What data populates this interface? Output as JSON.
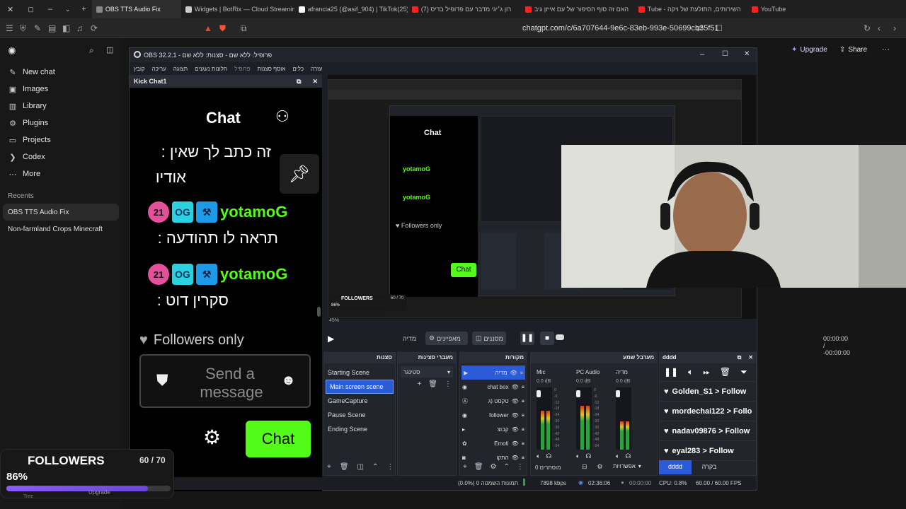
{
  "browser": {
    "tabs": [
      {
        "label": "OBS TTS Audio Fix",
        "active": true,
        "color": "#888888"
      },
      {
        "label": "Widgets | BotRix — Cloud Streamin",
        "active": false,
        "color": "#cccccc"
      },
      {
        "label": "afrancia25 (@asif_904) | TikTok(25)",
        "active": false,
        "color": "#ffffff"
      },
      {
        "label": "(7) רון ג׳יגי מדבר עם פדופיל בדיס",
        "active": false,
        "color": "#ff2020"
      },
      {
        "label": "האם זה סוף הסיפור של עם אייזן גיב",
        "active": false,
        "color": "#ff2020"
      },
      {
        "label": "Tube - השירותים, התולעת של ויקה",
        "active": false,
        "color": "#ff2020"
      },
      {
        "label": "YouTube",
        "active": false,
        "color": "#ff2020"
      }
    ],
    "url": "chatgpt.com/c/6a707644-9e6c-83eb-993e-50699cb35f51"
  },
  "sidebar": {
    "items": [
      {
        "label": "New chat",
        "icon": "edit-icon"
      },
      {
        "label": "Images",
        "icon": "image-icon"
      },
      {
        "label": "Library",
        "icon": "library-icon"
      },
      {
        "label": "Plugins",
        "icon": "plugins-icon"
      },
      {
        "label": "Projects",
        "icon": "folder-icon"
      },
      {
        "label": "Codex",
        "icon": "codex-icon"
      },
      {
        "label": "More",
        "icon": "more-icon"
      }
    ],
    "recent_heading": "Recents",
    "recents": [
      "OBS TTS Audio Fix",
      "Non-farmland Crops Minecraft"
    ]
  },
  "gpt_header": {
    "upgrade": "Upgrade",
    "share": "Share",
    "more": "···"
  },
  "obs": {
    "title": "OBS 32.2.1 - פרופיל: ללא שם - סצנות: ללא שם",
    "menu": [
      "קובץ",
      "עריכה",
      "תצוגה",
      "חלונות נעגנים",
      "פרופיל",
      "אוסף סצנות",
      "כלים",
      "עזרה"
    ],
    "dock_title": "Kick Chat1",
    "chat": {
      "header": "Chat",
      "line1": "זה כתב לך שאין :",
      "line1b": "אודיו",
      "user": "yotamoG",
      "badge": "21",
      "msg2": "תראה לו תהודעה :",
      "msg3": "סקרין דוט :",
      "followers_only": "Followers only",
      "send_placeholder_1": "Send a",
      "send_placeholder_2": "message",
      "chat_button": "Chat"
    },
    "controls": {
      "transition": "מדיה",
      "properties": "מאפיינים",
      "filters": "מסננים",
      "time": "00:00:00 / -00:00:00"
    },
    "scenes_title": "סצנות",
    "scenes": [
      "Starting Scene",
      "Main screen scene",
      "GameCapture",
      "Pause Scene",
      "Ending Scene"
    ],
    "selected_scene": "Main screen scene",
    "transitions_title": "מעברי סצינות",
    "transition_select": "סטינגר",
    "sources_title": "מקורות",
    "sources": [
      "מדיה",
      "chat box",
      "טקסט (ג",
      "follower",
      "קבוצ",
      "Emoti",
      "התקו"
    ],
    "mixer_title": "מערבל שמע",
    "mixer": [
      {
        "name": "Mic",
        "db": "0.0 dB",
        "level": 0.62
      },
      {
        "name": "PC Audio",
        "db": "0.0 dB",
        "level": 0.7
      },
      {
        "name": "מדיה",
        "db": "0.0 dB",
        "level": 0.45
      }
    ],
    "mixer_ticks": [
      "0",
      "-6",
      "-12",
      "-18",
      "-24",
      "-30",
      "-36",
      "-42",
      "-48",
      "-54"
    ],
    "mixer_footer": "0 מוסתרים",
    "advanced": "אפשרויות",
    "dock2_title": "dddd",
    "follow_list": [
      "Golden_S1 > Follow",
      "mordechai122 > Follo",
      "nadav09876 > Follow",
      "eyal283 > Follow"
    ],
    "dock_tabs": [
      "dddd",
      "בקרה"
    ],
    "status": {
      "dropped": "(0.0%) 0 תמונות השמטה",
      "kbps": "7898 kbps",
      "rec": "02:36:06",
      "stream": "00:00:00",
      "cpu": "CPU: 0.8%",
      "fps": "60.00 / 60.00 FPS"
    },
    "nested_zoom": "45%"
  },
  "overlay": {
    "title": "FOLLOWERS",
    "count": "60 / 70",
    "percent": "86%",
    "progress": 0.86,
    "upgrade": "Upgrade",
    "tree": "Tree"
  }
}
